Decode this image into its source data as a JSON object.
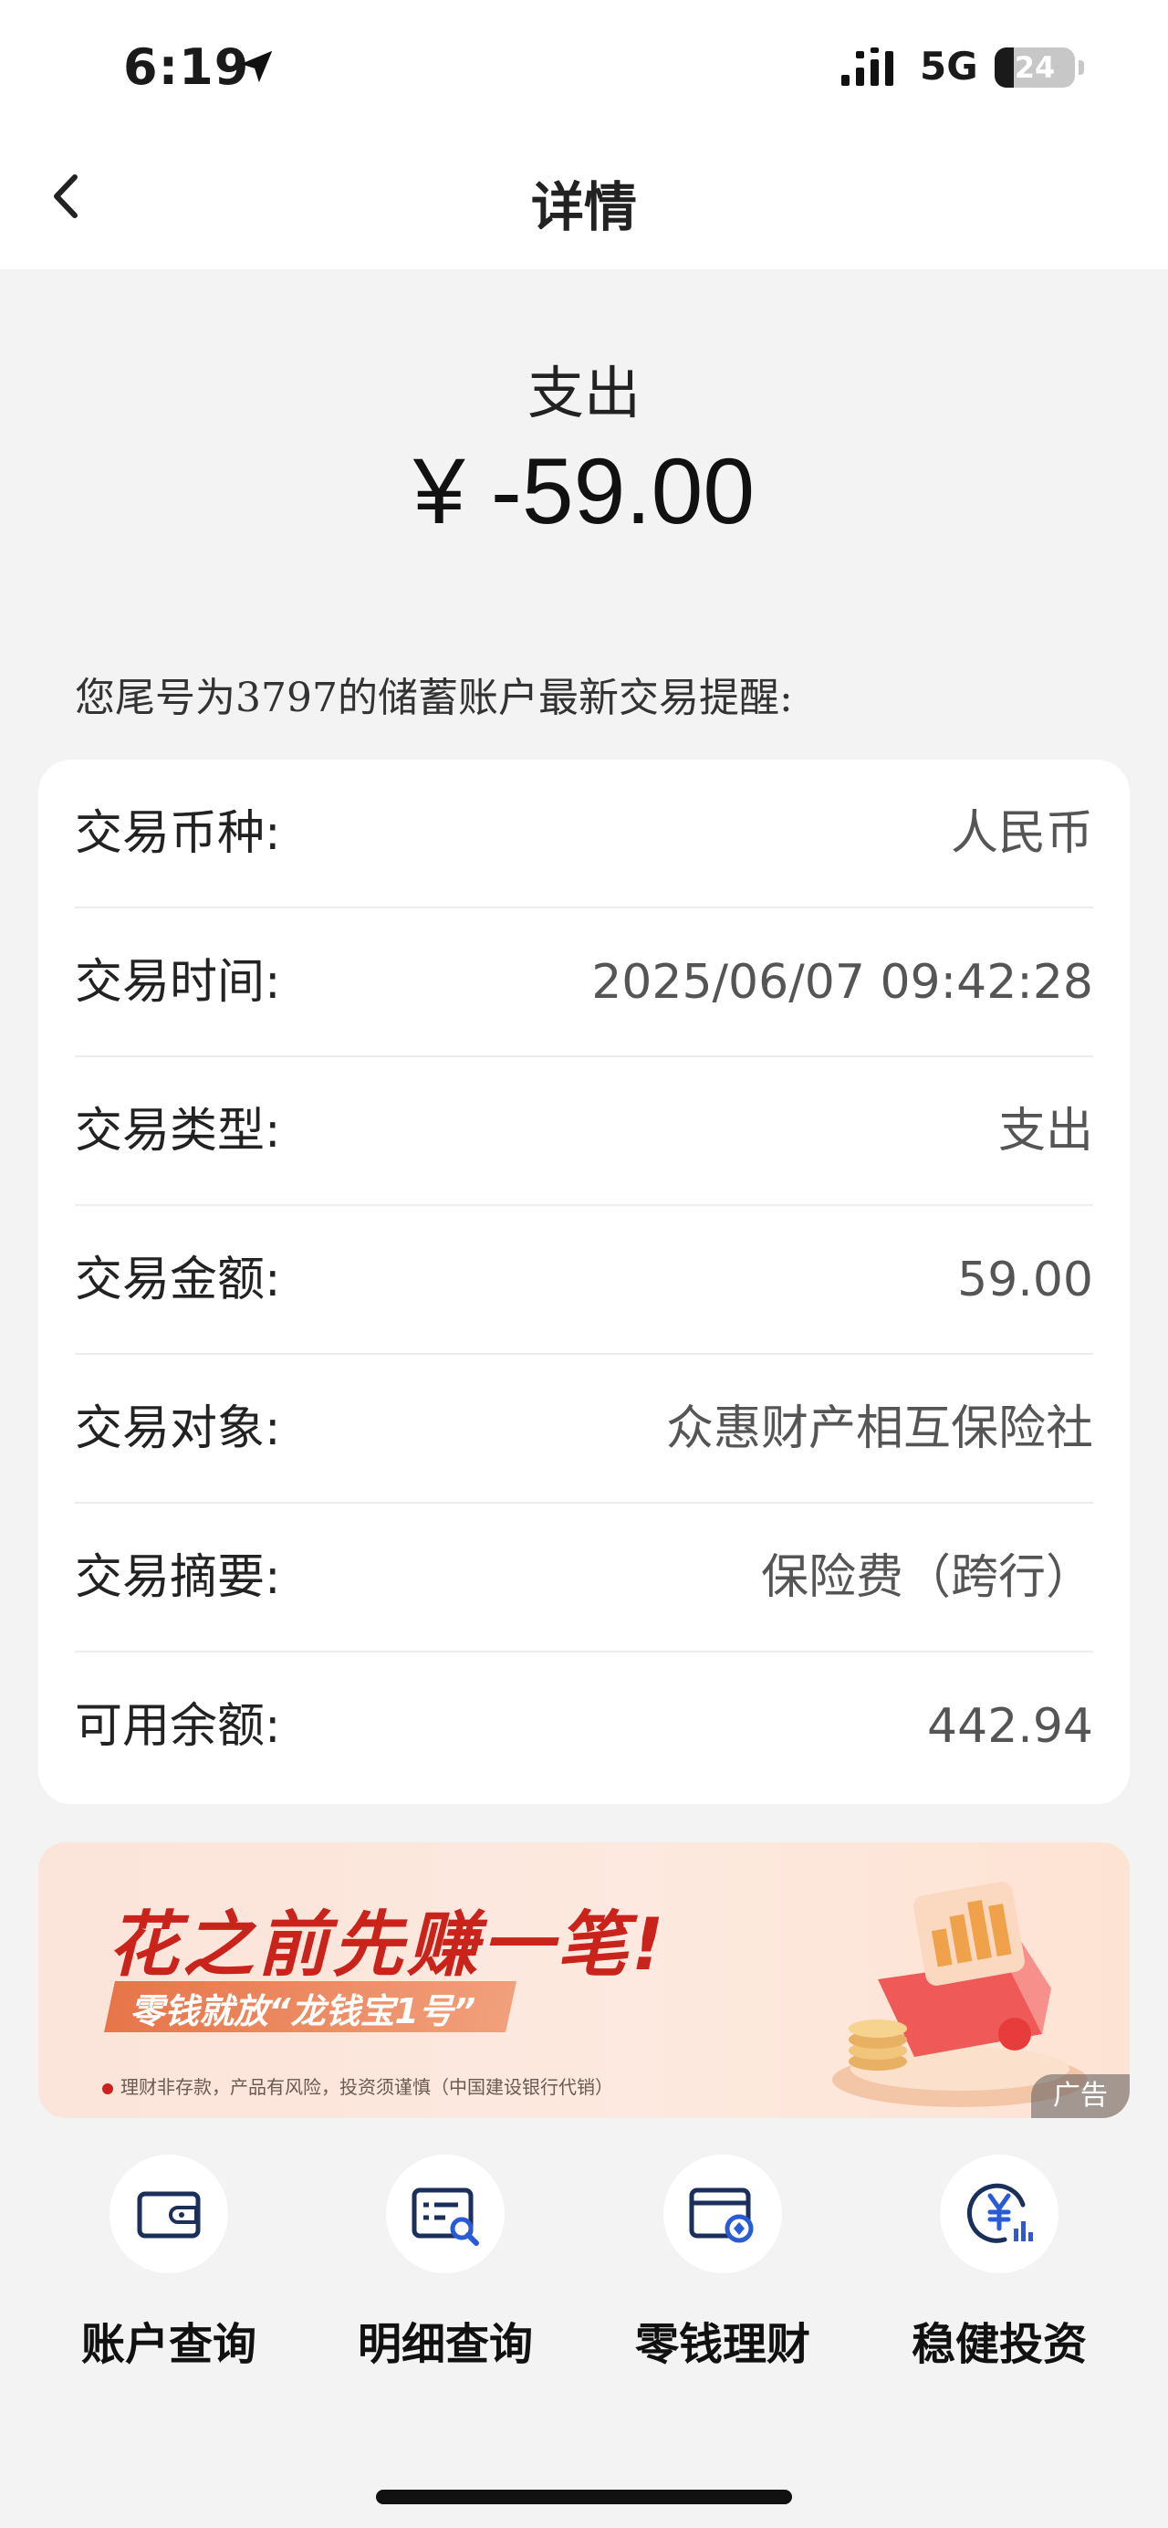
{
  "status_bar": {
    "time": "6:19",
    "network": "5G",
    "battery_level": "24",
    "battery_percent": 24
  },
  "nav": {
    "title": "详情",
    "back_icon": "chevron-left-icon"
  },
  "summary": {
    "type": "支出",
    "amount": "¥ -59.00"
  },
  "notice": "您尾号为3797的储蓄账户最新交易提醒:",
  "details": [
    {
      "label": "交易币种:",
      "value": "人民币"
    },
    {
      "label": "交易时间:",
      "value": "2025/06/07 09:42:28"
    },
    {
      "label": "交易类型:",
      "value": "支出"
    },
    {
      "label": "交易金额:",
      "value": "59.00"
    },
    {
      "label": "交易对象:",
      "value": "众惠财产相互保险社"
    },
    {
      "label": "交易摘要:",
      "value": "保险费（跨行）"
    },
    {
      "label": "可用余额:",
      "value": "442.94"
    }
  ],
  "ad": {
    "headline": "花之前先赚一笔!",
    "subline": "零钱就放“龙钱宝1号”",
    "disclaimer": "理财非存款，产品有风险，投资须谨慎（中国建设银行代销）",
    "tag": "广告",
    "accent_color": "#c9231c"
  },
  "quick_actions": [
    {
      "label": "账户查询",
      "icon": "wallet-icon"
    },
    {
      "label": "明细查询",
      "icon": "statement-search-icon"
    },
    {
      "label": "零钱理财",
      "icon": "card-finance-icon"
    },
    {
      "label": "稳健投资",
      "icon": "yuan-chart-icon"
    }
  ]
}
